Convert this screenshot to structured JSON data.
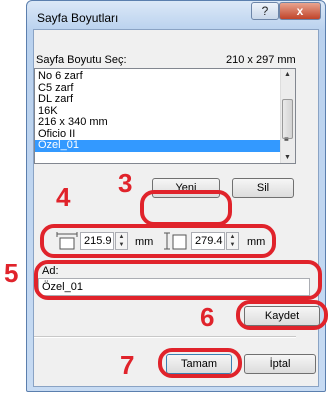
{
  "window": {
    "title": "Sayfa Boyutları",
    "help_glyph": "?",
    "close_glyph": "x"
  },
  "list_header": {
    "label": "Sayfa Boyutu Seç:",
    "size": "210 x 297 mm"
  },
  "sizes": [
    "No 6 zarf",
    "C5 zarf",
    "DL zarf",
    "16K",
    "216 x 340 mm",
    "Oficio II",
    "Özel_01"
  ],
  "selected_index": 6,
  "buttons": {
    "new": "Yeni",
    "delete": "Sil",
    "save": "Kaydet",
    "ok": "Tamam",
    "cancel": "İptal"
  },
  "dimensions": {
    "width": "215.9",
    "height": "279.4",
    "unit": "mm"
  },
  "name_field": {
    "label": "Ad:",
    "value": "Özel_01"
  },
  "callouts": {
    "n3": "3",
    "n4": "4",
    "n5": "5",
    "n6": "6",
    "n7": "7"
  },
  "colors": {
    "highlight": "#e0232b",
    "selection": "#3399ff"
  }
}
